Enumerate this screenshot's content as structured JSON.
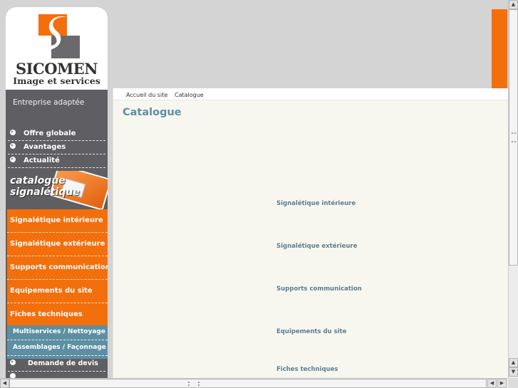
{
  "logo": {
    "name": "SICOMEN",
    "tagline": "Image et services"
  },
  "sidebar": {
    "entreprise": "Entreprise adaptée",
    "gray_items": [
      {
        "label": "Offre globale"
      },
      {
        "label": "Avantages"
      },
      {
        "label": "Actualité"
      }
    ],
    "catalogue_banner": {
      "line1": "catalogue",
      "line2": "signalétique"
    },
    "orange_items": [
      {
        "label": "Signalétique intérieure"
      },
      {
        "label": "Signalétique extérieure"
      },
      {
        "label": "Supports communication"
      },
      {
        "label": "Equipements du site"
      },
      {
        "label": "Fiches techniques"
      }
    ],
    "blue_items": [
      {
        "label": "Multiservices / Nettoyage"
      },
      {
        "label": "Assemblages / Façonnage /"
      }
    ],
    "devis": {
      "label": "Demande de devis"
    }
  },
  "breadcrumb": {
    "items": [
      "Accueil du site",
      "Catalogue"
    ]
  },
  "main": {
    "title": "Catalogue",
    "categories": [
      "Signalétique intérieure",
      "Signalétique extérieure",
      "Supports communication",
      "Equipements du site",
      "Fiches techniques"
    ]
  },
  "colors": {
    "orange": "#f36f0c",
    "gray": "#5f5f63",
    "blue": "#5d8fa3",
    "content_bg": "#f7f7f0"
  },
  "icons": [
    "logo-s-mark",
    "bullet-icon",
    "scroll-up-icon",
    "scroll-down-icon",
    "scroll-left-icon",
    "scroll-right-icon"
  ]
}
